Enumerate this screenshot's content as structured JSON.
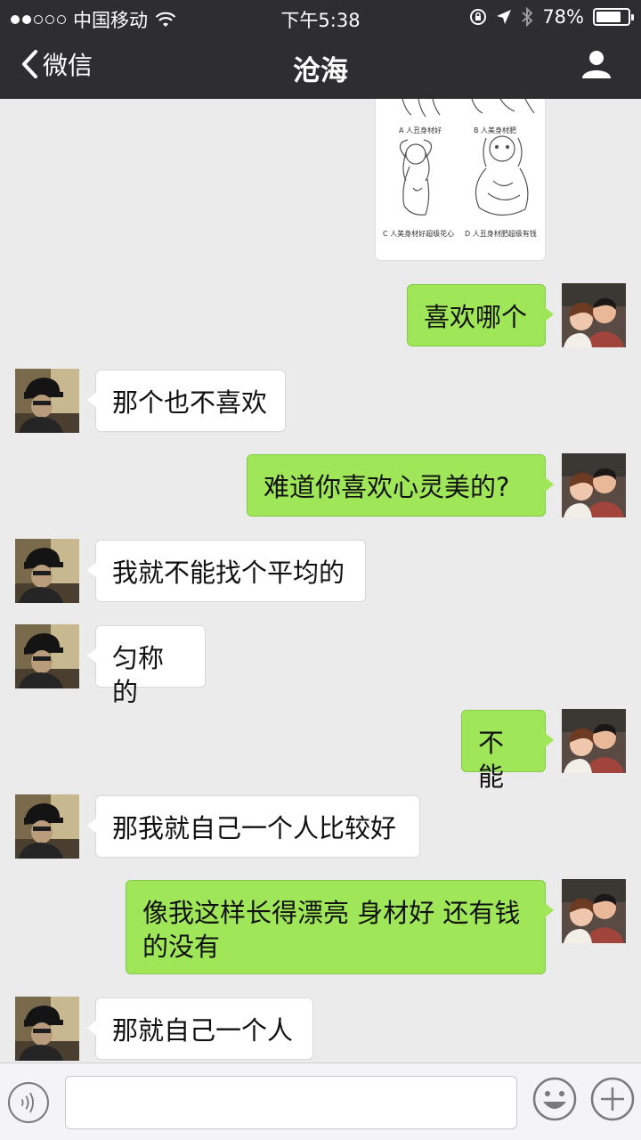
{
  "status": {
    "carrier": "中国移动",
    "time": "下午5:38",
    "battery_text": "78%",
    "battery_level": 0.78
  },
  "nav": {
    "back_label": "微信",
    "title": "沧海"
  },
  "image_message": {
    "captions": [
      "A 人丑身材好",
      "B 人美身材肥",
      "C 人美身材好超级花心",
      "D 人丑身材肥超级有钱"
    ]
  },
  "messages": [
    {
      "sender": "me",
      "text": "喜欢哪个"
    },
    {
      "sender": "other",
      "text": "那个也不喜欢"
    },
    {
      "sender": "me",
      "text": "难道你喜欢心灵美的?"
    },
    {
      "sender": "other",
      "text": "我就不能找个平均的"
    },
    {
      "sender": "other",
      "text": "匀称的"
    },
    {
      "sender": "me",
      "text": "不能"
    },
    {
      "sender": "other",
      "text": "那我就自己一个人比较好"
    },
    {
      "sender": "me",
      "text": "像我这样长得漂亮 身材好 还有钱的没有"
    },
    {
      "sender": "other",
      "text": "那就自己一个人"
    }
  ],
  "input": {
    "value": "",
    "placeholder": ""
  },
  "colors": {
    "header_bg": "#2e2e31",
    "chat_bg": "#ebebeb",
    "my_bubble": "#9fe658",
    "other_bubble": "#ffffff"
  }
}
